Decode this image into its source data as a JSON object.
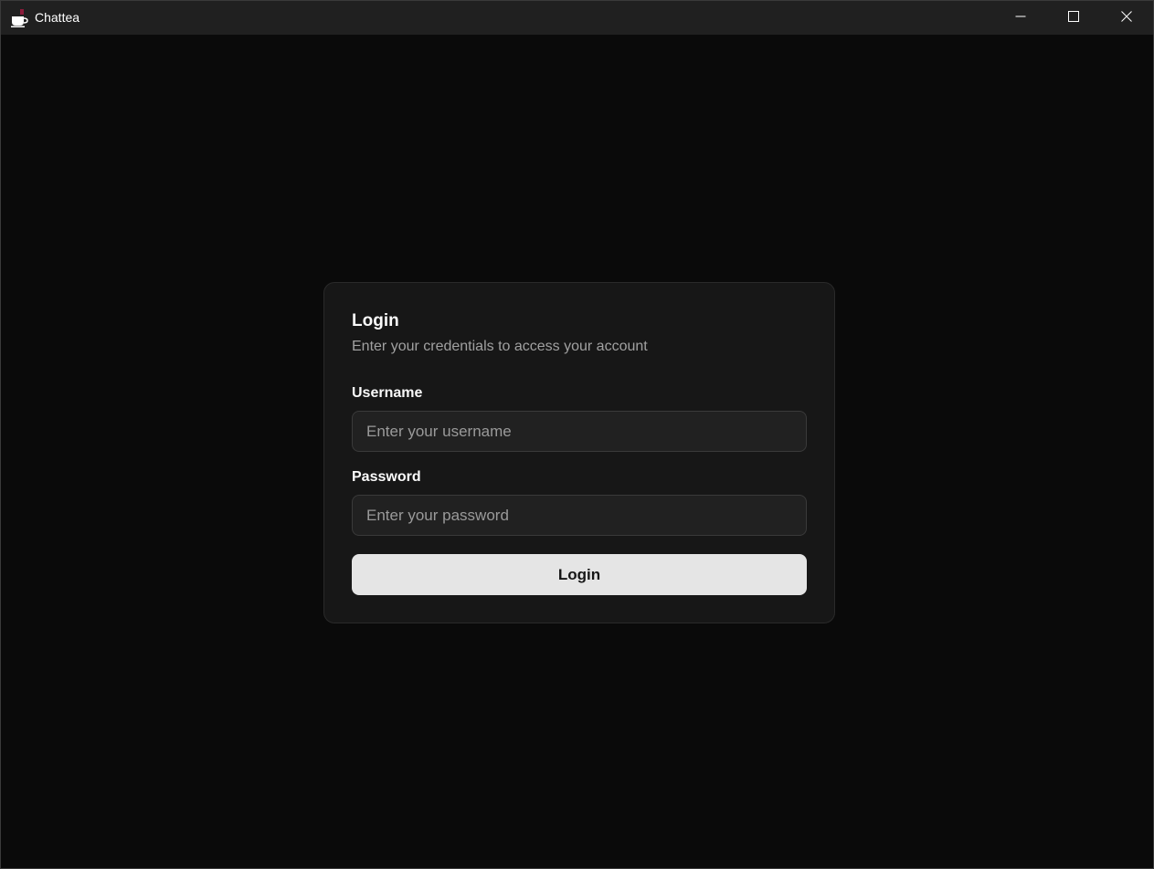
{
  "window": {
    "title": "Chattea",
    "icon": "coffee-cup-icon",
    "controls": [
      "minimize-icon",
      "maximize-icon",
      "close-icon"
    ]
  },
  "login_card": {
    "title": "Login",
    "description": "Enter your credentials to access your account",
    "username": {
      "label": "Username",
      "placeholder": "Enter your username",
      "value": ""
    },
    "password": {
      "label": "Password",
      "placeholder": "Enter your password",
      "value": ""
    },
    "submit_label": "Login"
  },
  "colors": {
    "background": "#0a0a0a",
    "titlebar": "#202020",
    "card": "#171717",
    "input": "#212121",
    "button": "#e5e5e5",
    "brand_accent": "#8b1a3a"
  }
}
